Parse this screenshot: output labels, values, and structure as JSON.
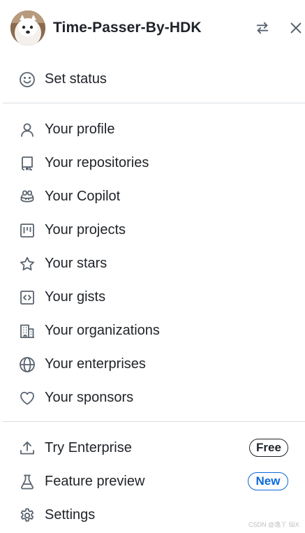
{
  "header": {
    "username": "Time-Passer-By-HDK",
    "switch_icon": "arrow-switch-icon",
    "close_icon": "x-close-icon"
  },
  "status": {
    "label": "Set status",
    "icon": "smiley-icon"
  },
  "menu_primary": [
    {
      "label": "Your profile",
      "icon": "person-icon"
    },
    {
      "label": "Your repositories",
      "icon": "repo-icon"
    },
    {
      "label": "Your Copilot",
      "icon": "copilot-icon"
    },
    {
      "label": "Your projects",
      "icon": "project-icon"
    },
    {
      "label": "Your stars",
      "icon": "star-icon"
    },
    {
      "label": "Your gists",
      "icon": "code-square-icon"
    },
    {
      "label": "Your organizations",
      "icon": "organization-icon"
    },
    {
      "label": "Your enterprises",
      "icon": "globe-icon"
    },
    {
      "label": "Your sponsors",
      "icon": "heart-icon"
    }
  ],
  "menu_secondary": [
    {
      "label": "Try Enterprise",
      "icon": "upload-icon",
      "badge": "Free"
    },
    {
      "label": "Feature preview",
      "icon": "beaker-icon",
      "badge": "New"
    },
    {
      "label": "Settings",
      "icon": "gear-icon"
    }
  ],
  "watermark": "CSDN @逸丫 仙X",
  "colors": {
    "text": "#1f2328",
    "icon": "#59636e",
    "divider": "#d8dee4",
    "accent": "#0969da"
  }
}
